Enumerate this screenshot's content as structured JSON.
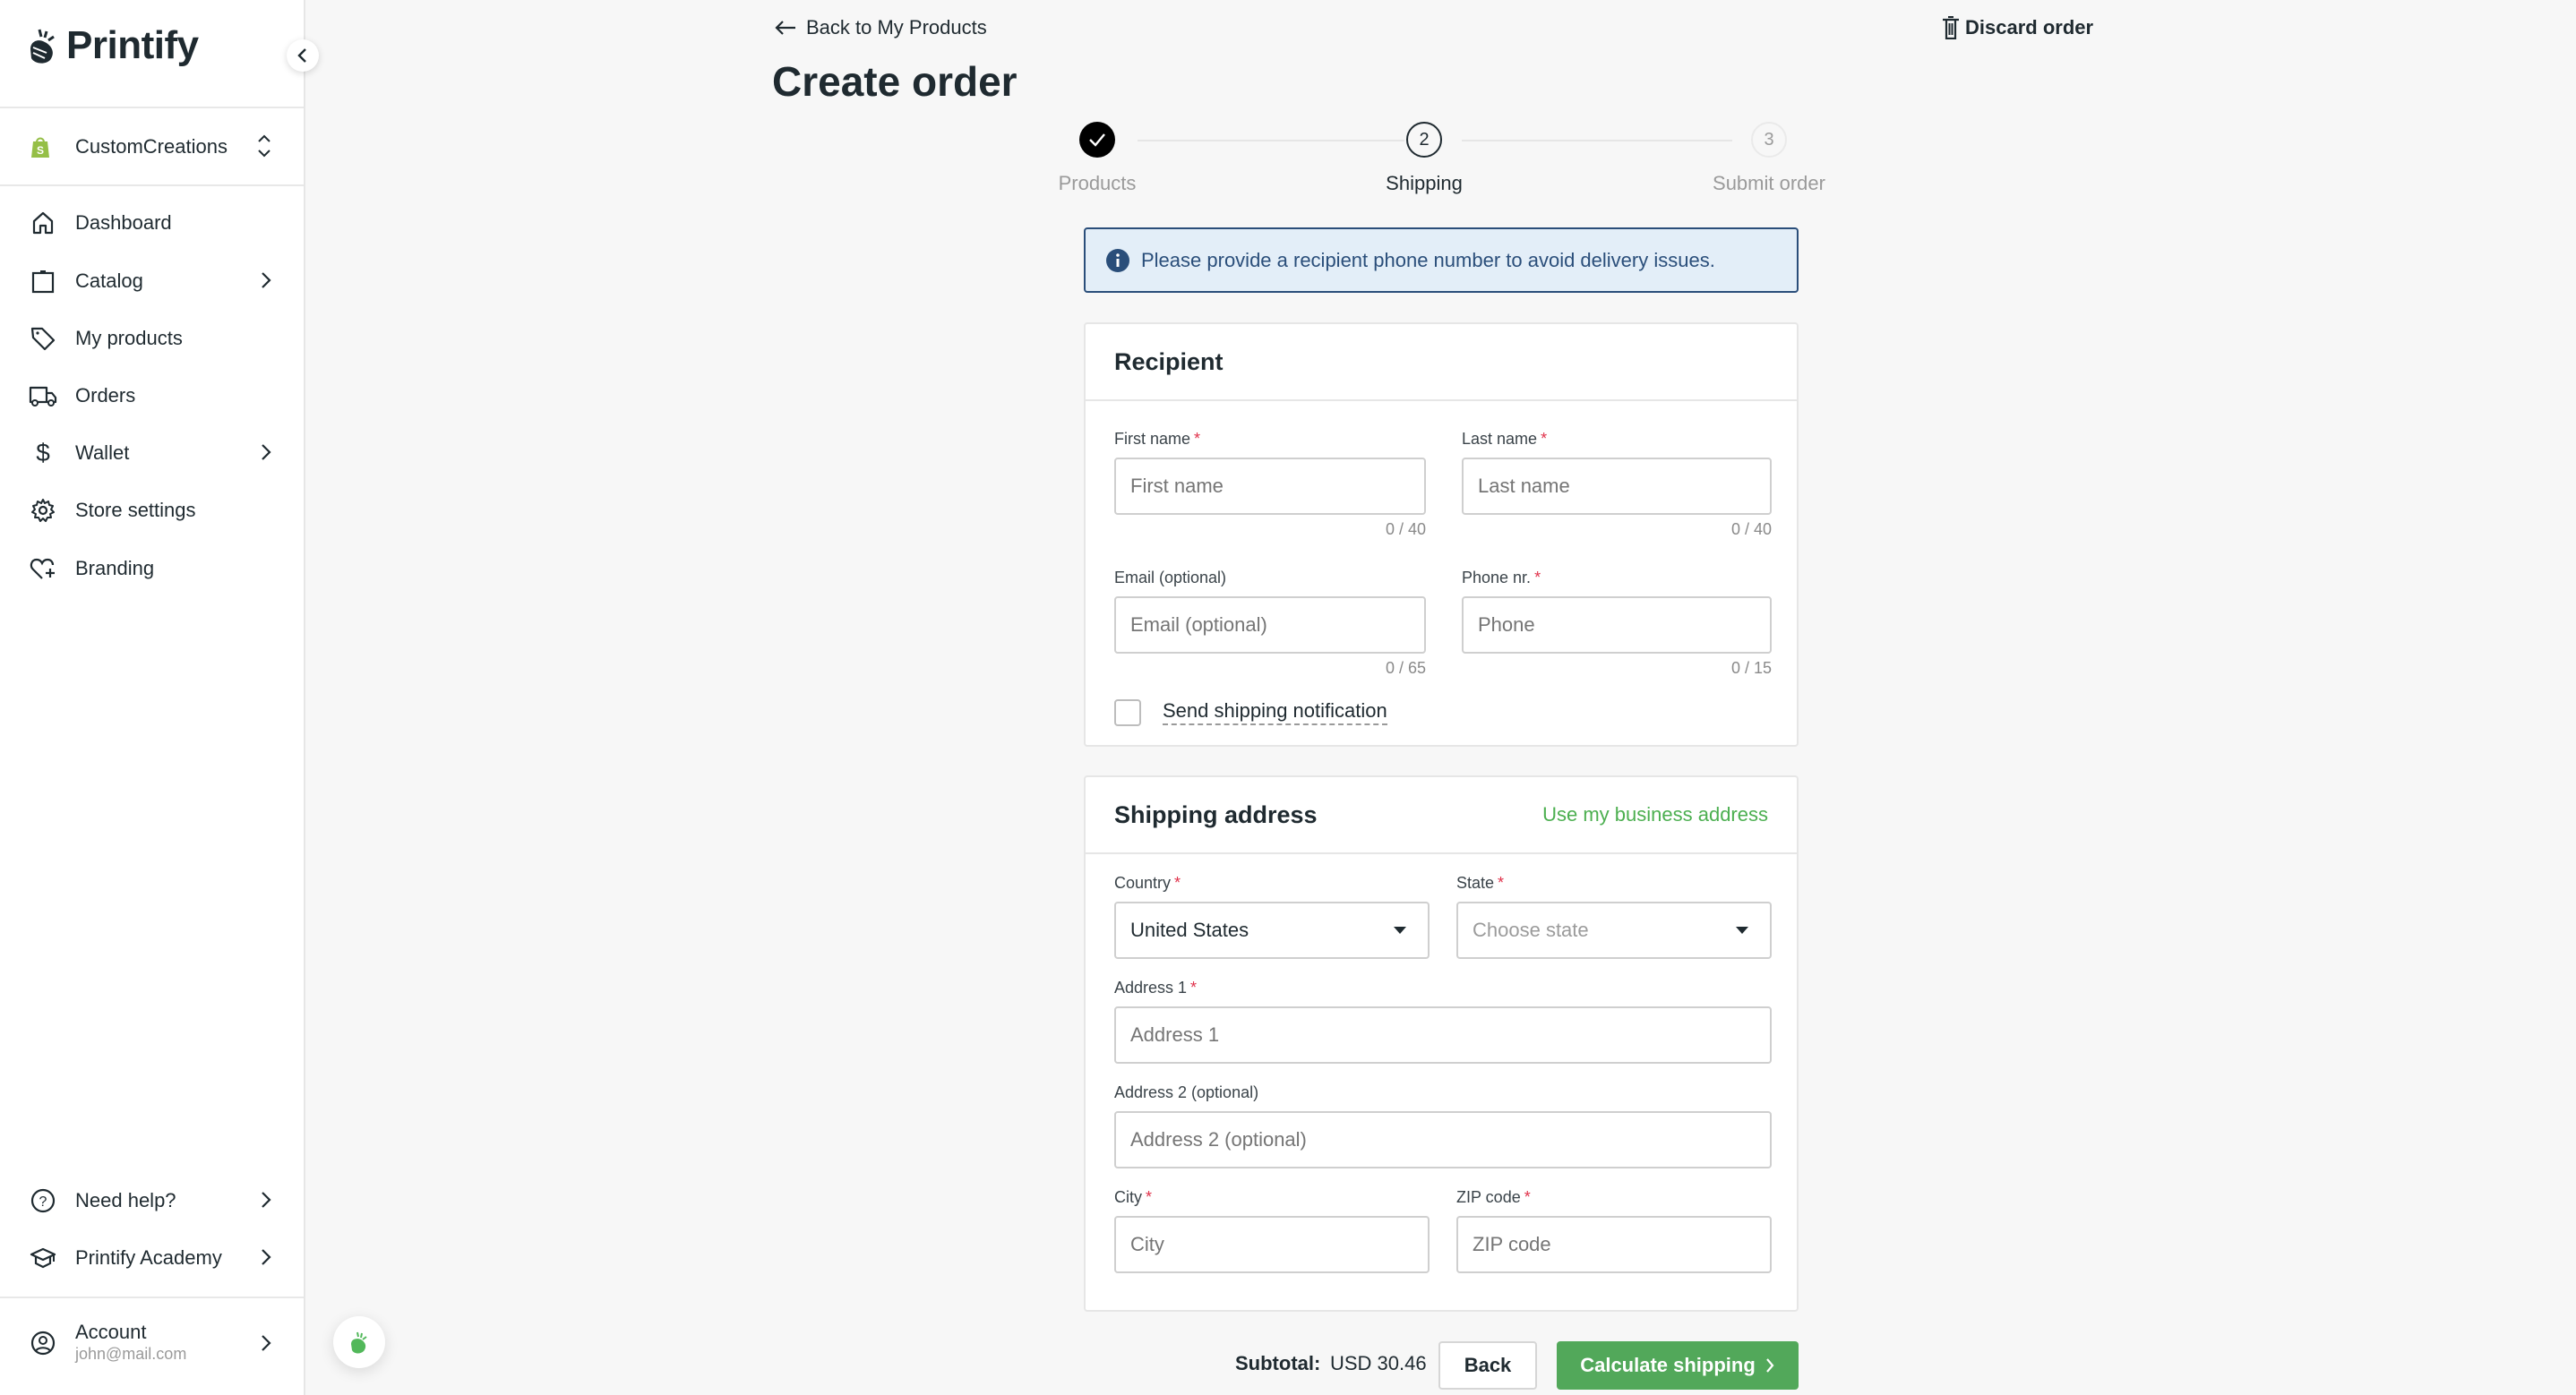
{
  "app": {
    "brand": "Printify"
  },
  "sidebar": {
    "store": {
      "name": "CustomCreations",
      "platform_icon": "shopify-icon"
    },
    "items": [
      {
        "label": "Dashboard",
        "icon": "home-icon",
        "has_submenu": false
      },
      {
        "label": "Catalog",
        "icon": "clipboard-icon",
        "has_submenu": true
      },
      {
        "label": "My products",
        "icon": "tag-icon",
        "has_submenu": false
      },
      {
        "label": "Orders",
        "icon": "truck-icon",
        "has_submenu": false
      },
      {
        "label": "Wallet",
        "icon": "dollar-icon",
        "has_submenu": true
      },
      {
        "label": "Store settings",
        "icon": "gear-icon",
        "has_submenu": false
      },
      {
        "label": "Branding",
        "icon": "heart-plus-icon",
        "has_submenu": false
      }
    ],
    "bottom_items": [
      {
        "label": "Need help?",
        "icon": "help-circle-icon",
        "has_submenu": true
      },
      {
        "label": "Printify Academy",
        "icon": "graduation-cap-icon",
        "has_submenu": true
      }
    ],
    "account": {
      "label": "Account",
      "email": "john@mail.com"
    }
  },
  "header": {
    "back_label": "Back to My Products",
    "title": "Create order",
    "discard_label": "Discard order"
  },
  "stepper": {
    "steps": [
      {
        "number": "1",
        "label": "Products",
        "state": "completed"
      },
      {
        "number": "2",
        "label": "Shipping",
        "state": "active"
      },
      {
        "number": "3",
        "label": "Submit order",
        "state": "pending"
      }
    ]
  },
  "banner": {
    "text": "Please provide a recipient phone number to avoid delivery issues."
  },
  "recipient": {
    "title": "Recipient",
    "first_name": {
      "label": "First name",
      "required": true,
      "placeholder": "First name",
      "value": "",
      "counter": "0 / 40"
    },
    "last_name": {
      "label": "Last name",
      "required": true,
      "placeholder": "Last name",
      "value": "",
      "counter": "0 / 40"
    },
    "email": {
      "label": "Email (optional)",
      "required": false,
      "placeholder": "Email (optional)",
      "value": "",
      "counter": "0 / 65"
    },
    "phone": {
      "label": "Phone nr.",
      "required": true,
      "placeholder": "Phone",
      "value": "",
      "counter": "0 / 15"
    },
    "notification": {
      "label": "Send shipping notification",
      "checked": false
    }
  },
  "shipping": {
    "title": "Shipping address",
    "business_link": "Use my business address",
    "country": {
      "label": "Country",
      "required": true,
      "value": "United States"
    },
    "state": {
      "label": "State",
      "required": true,
      "placeholder": "Choose state"
    },
    "address1": {
      "label": "Address 1",
      "required": true,
      "placeholder": "Address 1"
    },
    "address2": {
      "label": "Address 2 (optional)",
      "required": false,
      "placeholder": "Address 2 (optional)"
    },
    "city": {
      "label": "City",
      "required": true,
      "placeholder": "City"
    },
    "zip": {
      "label": "ZIP code",
      "required": true,
      "placeholder": "ZIP code"
    }
  },
  "footer": {
    "subtotal_label": "Subtotal:",
    "subtotal_value": "USD 30.46",
    "back_label": "Back",
    "calculate_label": "Calculate shipping"
  },
  "colors": {
    "accent_green": "#52a85a",
    "info_blue": "#2a4e7a",
    "required_red": "#e0324b"
  }
}
